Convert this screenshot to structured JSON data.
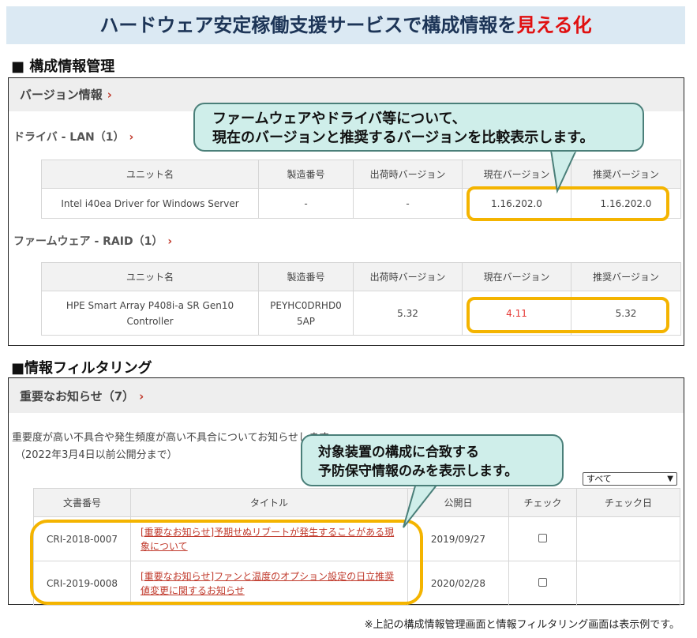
{
  "banner": {
    "text_main": "ハードウェア安定稼働支援サービスで構成情報を",
    "text_highlight": "見える化"
  },
  "section1": {
    "title": "■ 構成情報管理",
    "panel_title": "バージョン情報",
    "chevron": "›",
    "driver_title": "ドライバ - LAN（1）",
    "firmware_title": "ファームウェア - RAID（1）",
    "columns": [
      "ユニット名",
      "製造番号",
      "出荷時バージョン",
      "現在バージョン",
      "推奨バージョン"
    ],
    "driver_row": [
      "Intel i40ea Driver for Windows Server",
      "-",
      "-",
      "1.16.202.0",
      "1.16.202.0"
    ],
    "firmware_row": [
      "HPE Smart Array P408i-a SR Gen10 Controller",
      "PEYHC0DRHD0 5AP",
      "5.32",
      "4.11",
      "5.32"
    ],
    "callout_line1": "ファームウェアやドライバ等について、",
    "callout_line2": "現在のバージョンと推奨するバージョンを比較表示します。"
  },
  "section2": {
    "title": "■情報フィルタリング",
    "panel_title": "重要なお知らせ（7）",
    "chevron": "›",
    "description": "重要度が高い不具合や発生頻度が高い不具合についてお知らせします。",
    "date_note": "（2022年3月4日以前公開分まで）",
    "filter_value": "すべて",
    "columns": [
      "文書番号",
      "タイトル",
      "公開日",
      "チェック",
      "チェック日"
    ],
    "rows": [
      {
        "doc": "CRI-2018-0007",
        "title": "[重要なお知らせ]予期せぬリブートが発生することがある現象について",
        "date": "2019/09/27",
        "checked": "",
        "check_date": ""
      },
      {
        "doc": "CRI-2019-0008",
        "title": "[重要なお知らせ]ファンと温度のオプション設定の日立推奨値変更に関するお知らせ",
        "date": "2020/02/28",
        "checked": "",
        "check_date": ""
      }
    ],
    "callout_line1": "対象装置の構成に合致する",
    "callout_line2": "予防保守情報のみを表示します。"
  },
  "footnote": "※上記の構成情報管理画面と情報フィルタリング画面は表示例です。",
  "colors": {
    "highlight": "#f4b400",
    "callout": "#cfeeea",
    "accent": "#c0392b",
    "banner": "#dbe9f3"
  }
}
